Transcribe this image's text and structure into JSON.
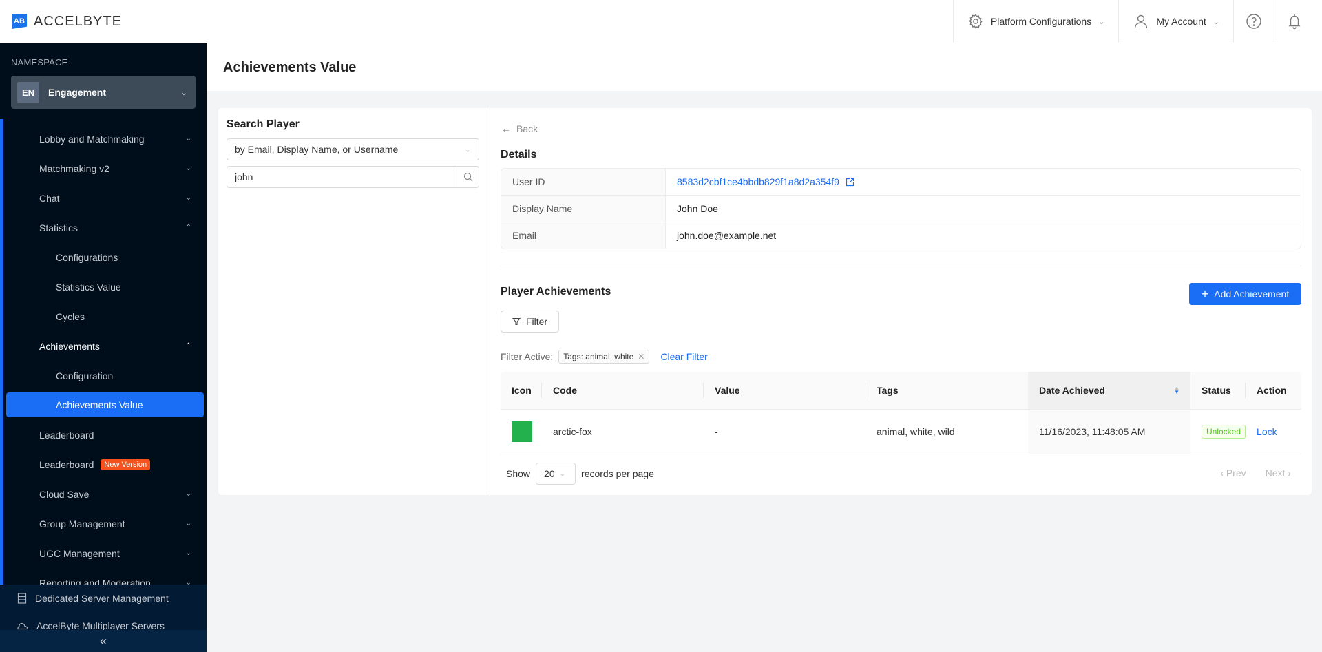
{
  "app": {
    "brand": "ACCELBYTE",
    "brand_mark": "AB"
  },
  "topbar": {
    "platform_config": "Platform Configurations",
    "my_account": "My Account"
  },
  "sidebar": {
    "namespace_label": "NAMESPACE",
    "namespace_badge": "EN",
    "namespace_name": "Engagement",
    "items": [
      {
        "label": "Lobby and Matchmaking",
        "chevron": "down"
      },
      {
        "label": "Matchmaking v2",
        "chevron": "down"
      },
      {
        "label": "Chat",
        "chevron": "down"
      },
      {
        "label": "Statistics",
        "chevron": "up"
      },
      {
        "label": "Configurations"
      },
      {
        "label": "Statistics Value"
      },
      {
        "label": "Cycles"
      },
      {
        "label": "Achievements",
        "chevron": "up"
      },
      {
        "label": "Configuration"
      },
      {
        "label": "Achievements Value",
        "active": true
      },
      {
        "label": "Leaderboard"
      },
      {
        "label": "Leaderboard",
        "badge": "New Version"
      },
      {
        "label": "Cloud Save",
        "chevron": "down"
      },
      {
        "label": "Group Management",
        "chevron": "down"
      },
      {
        "label": "UGC Management",
        "chevron": "down"
      },
      {
        "label": "Reporting and Moderation",
        "chevron": "down"
      }
    ],
    "bottom_items": [
      {
        "label": "Dedicated Server Management",
        "icon": "server-icon"
      },
      {
        "label": "AccelByte Multiplayer Servers",
        "icon": "cloud-icon"
      }
    ],
    "collapse_label": "«"
  },
  "page": {
    "title": "Achievements Value"
  },
  "search": {
    "title": "Search Player",
    "mode": "by Email, Display Name, or Username",
    "query": "john"
  },
  "details": {
    "back_label": "Back",
    "title": "Details",
    "rows": [
      {
        "label": "User ID",
        "value": "8583d2cbf1ce4bbdb829f1a8d2a354f9"
      },
      {
        "label": "Display Name",
        "value": "John Doe"
      },
      {
        "label": "Email",
        "value": "john.doe@example.net"
      }
    ]
  },
  "achievements": {
    "title": "Player Achievements",
    "add_label": "Add Achievement",
    "filter_label": "Filter",
    "filter_active_label": "Filter Active:",
    "filter_chip": "Tags: animal, white",
    "clear_filter_label": "Clear Filter",
    "columns": [
      "Icon",
      "Code",
      "Value",
      "Tags",
      "Date Achieved",
      "Status",
      "Action"
    ],
    "rows": [
      {
        "icon_color": "#22b14c",
        "code": "arctic-fox",
        "value": "-",
        "tags": "animal, white, wild",
        "date": "11/16/2023, 11:48:05 AM",
        "status": "Unlocked",
        "action": "Lock"
      }
    ],
    "pager": {
      "show_label": "Show",
      "page_size": "20",
      "per_page_label": "records per page",
      "prev_label": "Prev",
      "next_label": "Next"
    }
  },
  "colors": {
    "accent": "#1a6df5",
    "sidebar_bg": "#000e1c",
    "badge_new": "#f5521f",
    "status_unlocked": "#52c41a"
  }
}
